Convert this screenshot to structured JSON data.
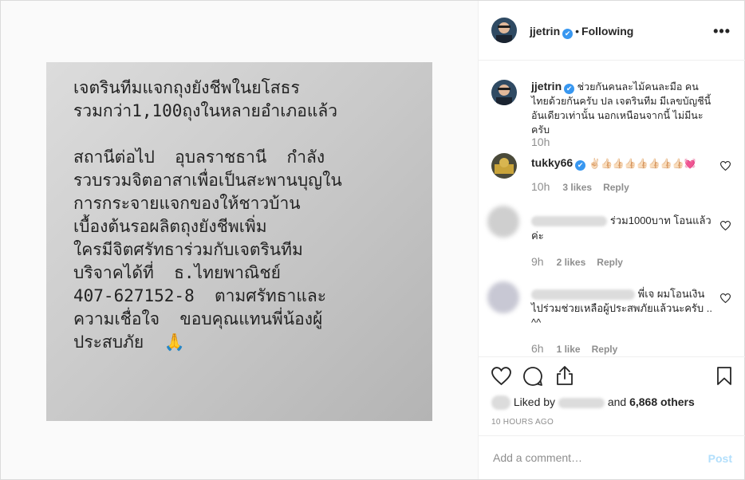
{
  "post_image": {
    "text": "เจตรินทีมแจกถุงยังชีพในยโสธร\nรวมกว่า1,100ถุงในหลายอำเภอแล้ว\n\nสถานีต่อไป  อุบลราชธานี  กำลัง\nรวบรวมจิตอาสาเพื่อเป็นสะพานบุญใน\nการกระจายแจกของให้ชาวบ้าน\nเบื้องต้นรอผลิตถุงยังชีพเพิ่ม\nใครมีจิตศรัทธาร่วมกับเจตรินทีม\nบริจาคได้ที่  ธ.ไทยพาณิชย์\n407-627152-8  ตามศรัทธาและ\nความเชื่อใจ  ขอบคุณแทนพี่น้องผู้\nประสบภัย  🙏"
  },
  "header": {
    "username": "jjetrin",
    "verified_mark": "✔",
    "separator": "•",
    "follow_status": "Following",
    "more_label": "•••"
  },
  "comments": [
    {
      "username": "jjetrin",
      "text": "ช่วยกันคนละไม้คนละมือ คนไทยด้วยกันครับ ปล เจตรินทีม มีเลขบัญชีนี้ อันเดียวเท่านั้น นอกเหนือนจากนี้ ไม่มีนะครับ",
      "time": "10h"
    },
    {
      "username": "tukky66",
      "text": "✌🏻👍🏻👍🏻👍🏻👍🏻👍🏻👍🏻👍🏻💓",
      "time": "10h",
      "likes": "3 likes",
      "reply": "Reply"
    },
    {
      "text": "ร่วม1000บาท โอนแล้วค่ะ",
      "time": "9h",
      "likes": "2 likes",
      "reply": "Reply"
    },
    {
      "text": "พี่เจ ผมโอนเงินไปร่วมช่วยเหลือผู้ประสพภัยแล้วนะครับ .. ^^",
      "time": "6h",
      "likes": "1 like",
      "reply": "Reply"
    }
  ],
  "likes_line": {
    "prefix": "Liked by",
    "middle": "and",
    "count": "6,868 others"
  },
  "timestamp": "10 HOURS AGO",
  "add_comment": {
    "placeholder": "Add a comment…",
    "post_label": "Post"
  },
  "colors": {
    "verified": "#3897f0",
    "post_button_disabled": "#b2dffc",
    "muted_text": "#8e8e8e"
  },
  "icons": [
    "heart-icon",
    "comment-icon",
    "share-icon",
    "bookmark-icon",
    "small-heart-icon",
    "more-options-icon"
  ]
}
